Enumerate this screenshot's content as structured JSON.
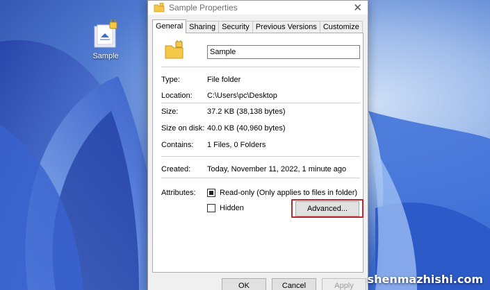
{
  "desktop": {
    "icon_label": "Sample"
  },
  "dialog": {
    "title": "Sample Properties",
    "close_glyph": "✕",
    "tabs": [
      {
        "label": "General"
      },
      {
        "label": "Sharing"
      },
      {
        "label": "Security"
      },
      {
        "label": "Previous Versions"
      },
      {
        "label": "Customize"
      }
    ],
    "name_value": "Sample",
    "fields": {
      "type_label": "Type:",
      "type_value": "File folder",
      "location_label": "Location:",
      "location_value": "C:\\Users\\pc\\Desktop",
      "size_label": "Size:",
      "size_value": "37.2 KB (38,138 bytes)",
      "size_on_disk_label": "Size on disk:",
      "size_on_disk_value": "40.0 KB (40,960 bytes)",
      "contains_label": "Contains:",
      "contains_value": "1 Files, 0 Folders",
      "created_label": "Created:",
      "created_value": "Today, November 11, 2022, 1 minute ago",
      "attributes_label": "Attributes:"
    },
    "attributes": {
      "readonly_label": "Read-only (Only applies to files in folder)",
      "readonly_state": "indeterminate",
      "hidden_label": "Hidden",
      "hidden_state": "unchecked",
      "advanced_label": "Advanced..."
    },
    "buttons": {
      "ok": "OK",
      "cancel": "Cancel",
      "apply": "Apply"
    }
  },
  "colors": {
    "highlight_box": "#c0262c",
    "folder_yellow": "#f5c84a"
  },
  "watermark": "shenmazhishi.com"
}
